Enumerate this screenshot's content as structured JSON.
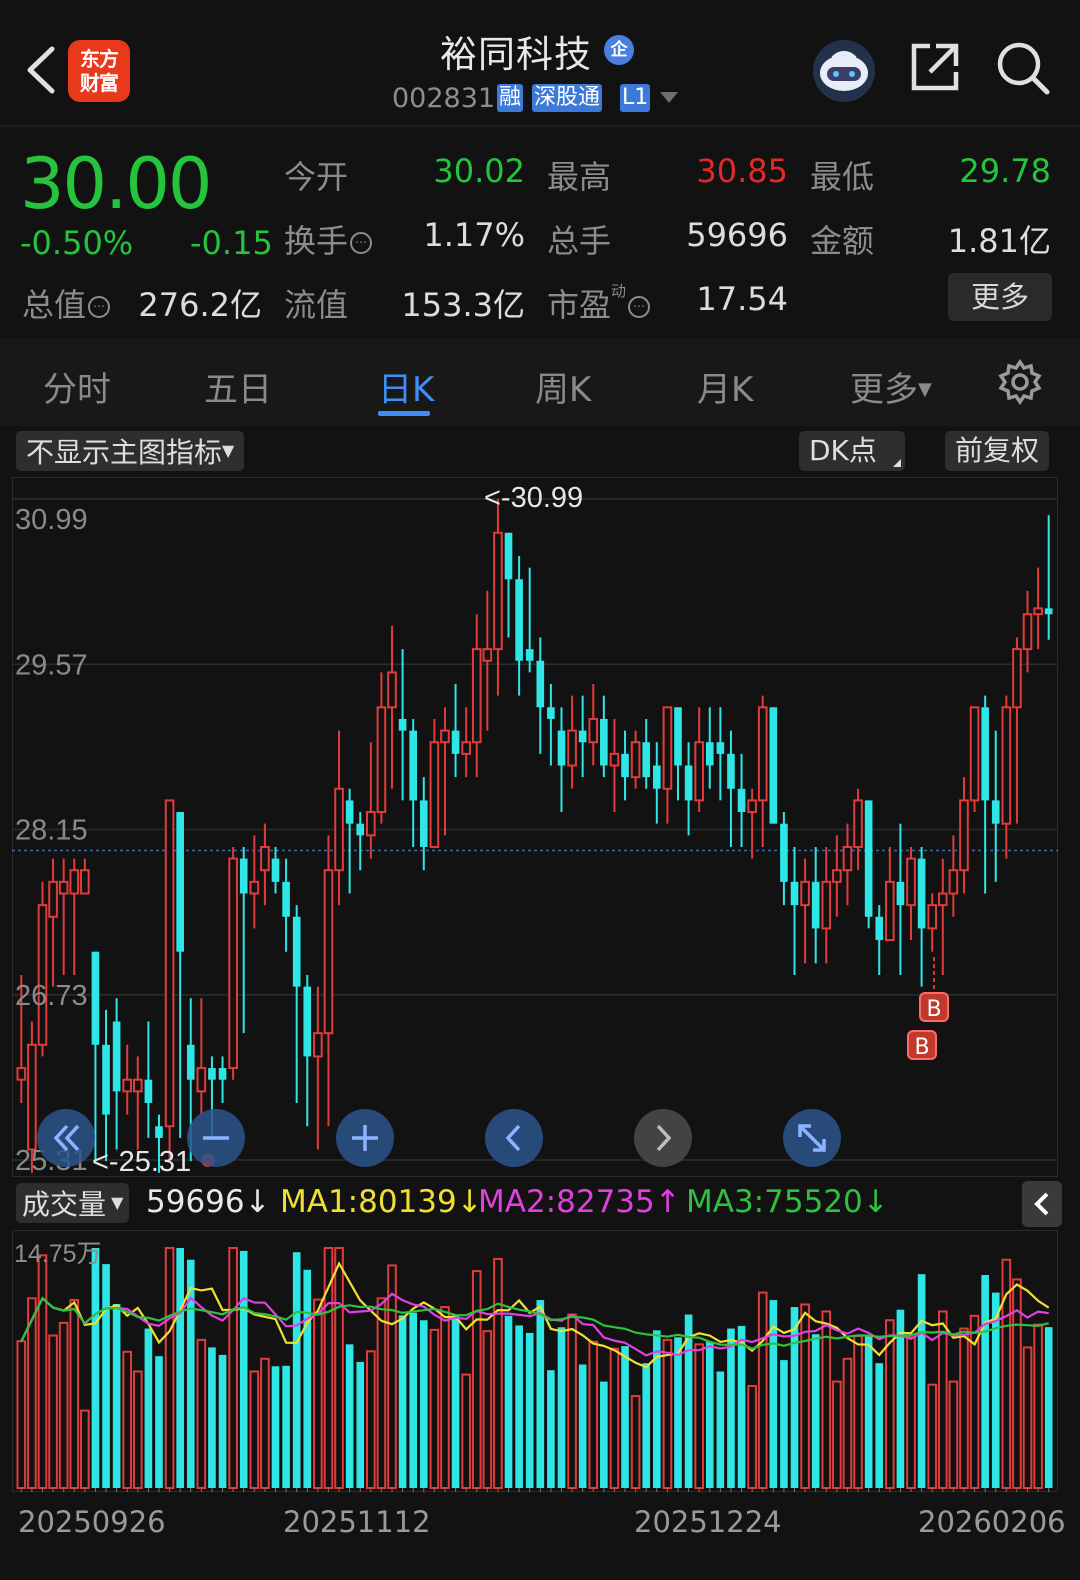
{
  "header": {
    "brand": "东方财富",
    "stock_name": "裕同科技",
    "qi_badge": "企",
    "code": "002831",
    "tags": [
      "融",
      "深股通",
      "L1"
    ]
  },
  "quote": {
    "price": "30.00",
    "pct_change": "-0.50%",
    "abs_change": "-0.15",
    "rows": [
      [
        {
          "label": "今开",
          "value": "30.02",
          "color": "#24c43c"
        },
        {
          "label": "最高",
          "value": "30.85",
          "color": "#e02a2a"
        },
        {
          "label": "最低",
          "value": "29.78",
          "color": "#24c43c"
        }
      ],
      [
        {
          "label": "换手",
          "value": "1.17%",
          "color": "#dcdcdc",
          "info": true
        },
        {
          "label": "总手",
          "value": "59696",
          "color": "#dcdcdc"
        },
        {
          "label": "金额",
          "value": "1.81亿",
          "color": "#dcdcdc"
        }
      ],
      [
        {
          "label": "总值",
          "value": "276.2亿",
          "color": "#dcdcdc",
          "info": true
        },
        {
          "label": "流值",
          "value": "153.3亿",
          "color": "#dcdcdc"
        },
        {
          "label": "市盈",
          "value": "17.54",
          "color": "#dcdcdc",
          "info": true,
          "sup": "动"
        }
      ]
    ],
    "more_label": "更多"
  },
  "tabs": {
    "items": [
      "分时",
      "五日",
      "日K",
      "周K",
      "月K",
      "更多"
    ],
    "active": "日K"
  },
  "toolbar": {
    "indicator_select": "不显示主图指标",
    "dk_label": "DK点",
    "adjust_label": "前复权"
  },
  "chart_data": {
    "type": "candlestick",
    "y_ticks": [
      "30.99",
      "29.57",
      "28.15",
      "26.73",
      "25.31"
    ],
    "ylim": [
      25.31,
      30.99
    ],
    "high_marker": "<-30.99",
    "low_marker": "<-25.31",
    "current_price_line": 27.97,
    "signal_labels": [
      "B",
      "B"
    ],
    "x_labels": [
      "20250926",
      "20251112",
      "20251224",
      "20260206"
    ],
    "candles": [
      [
        26.0,
        26.1,
        25.8,
        26.9
      ],
      [
        25.4,
        26.3,
        25.2,
        26.5
      ],
      [
        26.3,
        27.5,
        26.2,
        27.7
      ],
      [
        27.4,
        27.7,
        26.8,
        27.9
      ],
      [
        27.6,
        27.7,
        26.9,
        27.9
      ],
      [
        27.6,
        27.8,
        26.9,
        27.9
      ],
      [
        27.6,
        27.8,
        27.6,
        27.9
      ],
      [
        27.1,
        26.3,
        25.3,
        27.1
      ],
      [
        26.3,
        25.7,
        25.3,
        26.6
      ],
      [
        26.5,
        25.9,
        25.4,
        26.7
      ],
      [
        25.9,
        26.0,
        25.7,
        26.3
      ],
      [
        25.9,
        26.0,
        25.4,
        26.2
      ],
      [
        26.0,
        25.8,
        25.5,
        26.5
      ],
      [
        25.6,
        25.5,
        25.2,
        25.7
      ],
      [
        25.6,
        28.4,
        25.3,
        28.4
      ],
      [
        28.3,
        27.1,
        25.5,
        28.3
      ],
      [
        26.3,
        26.0,
        25.3,
        26.7
      ],
      [
        25.9,
        26.1,
        25.7,
        26.7
      ],
      [
        26.1,
        26.0,
        25.5,
        26.2
      ],
      [
        26.1,
        26.0,
        25.8,
        26.2
      ],
      [
        26.1,
        27.9,
        26.0,
        28.0
      ],
      [
        27.9,
        27.6,
        26.4,
        28.0
      ],
      [
        27.6,
        27.7,
        27.3,
        28.1
      ],
      [
        27.8,
        28.0,
        27.5,
        28.2
      ],
      [
        27.9,
        27.7,
        27.6,
        28.0
      ],
      [
        27.7,
        27.4,
        27.1,
        27.9
      ],
      [
        27.4,
        26.8,
        25.8,
        27.5
      ],
      [
        26.8,
        26.2,
        25.6,
        26.9
      ],
      [
        26.2,
        26.4,
        25.4,
        26.8
      ],
      [
        26.4,
        27.8,
        25.6,
        28.1
      ],
      [
        27.8,
        28.5,
        27.5,
        29.0
      ],
      [
        28.4,
        28.2,
        27.6,
        28.5
      ],
      [
        28.2,
        28.1,
        27.8,
        28.3
      ],
      [
        28.1,
        28.3,
        27.9,
        28.9
      ],
      [
        28.3,
        29.2,
        28.2,
        29.5
      ],
      [
        29.2,
        29.5,
        28.5,
        29.9
      ],
      [
        29.1,
        29.0,
        28.4,
        29.7
      ],
      [
        29.0,
        28.4,
        28.0,
        29.1
      ],
      [
        28.4,
        28.0,
        27.8,
        28.6
      ],
      [
        28.0,
        28.9,
        28.0,
        29.1
      ],
      [
        28.9,
        29.0,
        28.1,
        29.2
      ],
      [
        29.0,
        28.8,
        28.6,
        29.4
      ],
      [
        28.8,
        28.9,
        28.6,
        29.2
      ],
      [
        28.9,
        29.7,
        28.6,
        30.0
      ],
      [
        29.6,
        29.7,
        29.0,
        30.2
      ],
      [
        29.7,
        30.7,
        29.3,
        30.99
      ],
      [
        30.7,
        30.3,
        29.8,
        30.7
      ],
      [
        30.3,
        29.6,
        29.3,
        30.5
      ],
      [
        29.7,
        29.6,
        29.5,
        30.4
      ],
      [
        29.6,
        29.2,
        28.8,
        29.8
      ],
      [
        29.2,
        29.1,
        28.7,
        29.4
      ],
      [
        29.0,
        28.7,
        28.3,
        29.2
      ],
      [
        28.7,
        29.0,
        28.5,
        29.3
      ],
      [
        29.0,
        28.9,
        28.6,
        29.3
      ],
      [
        28.9,
        29.1,
        28.7,
        29.4
      ],
      [
        29.1,
        28.7,
        28.6,
        29.3
      ],
      [
        28.7,
        28.8,
        28.3,
        29.1
      ],
      [
        28.8,
        28.6,
        28.4,
        29.0
      ],
      [
        28.6,
        28.9,
        28.5,
        29.0
      ],
      [
        28.9,
        28.6,
        28.5,
        29.1
      ],
      [
        28.7,
        28.5,
        28.2,
        28.9
      ],
      [
        28.5,
        29.2,
        28.2,
        29.2
      ],
      [
        29.2,
        28.7,
        28.4,
        29.2
      ],
      [
        28.7,
        28.4,
        28.1,
        28.9
      ],
      [
        28.4,
        28.9,
        28.3,
        29.2
      ],
      [
        28.9,
        28.7,
        28.5,
        29.2
      ],
      [
        28.9,
        28.8,
        28.4,
        29.2
      ],
      [
        28.8,
        28.5,
        28.0,
        29.0
      ],
      [
        28.5,
        28.3,
        28.0,
        28.8
      ],
      [
        28.3,
        28.4,
        27.9,
        28.5
      ],
      [
        28.4,
        29.2,
        28.0,
        29.3
      ],
      [
        29.2,
        28.2,
        28.2,
        29.2
      ],
      [
        28.2,
        27.7,
        27.5,
        28.3
      ],
      [
        27.7,
        27.5,
        26.9,
        28.0
      ],
      [
        27.5,
        27.7,
        27.0,
        27.9
      ],
      [
        27.7,
        27.3,
        27.0,
        28.0
      ],
      [
        27.3,
        27.7,
        27.0,
        28.0
      ],
      [
        27.7,
        27.8,
        27.4,
        28.1
      ],
      [
        27.8,
        28.0,
        27.5,
        28.2
      ],
      [
        28.0,
        28.4,
        27.8,
        28.5
      ],
      [
        28.4,
        27.4,
        27.3,
        28.4
      ],
      [
        27.4,
        27.2,
        26.9,
        27.5
      ],
      [
        27.2,
        27.7,
        27.2,
        28.0
      ],
      [
        27.7,
        27.5,
        26.9,
        28.2
      ],
      [
        27.5,
        27.9,
        27.2,
        28.0
      ],
      [
        27.9,
        27.3,
        26.8,
        28.0
      ],
      [
        27.3,
        27.5,
        27.1,
        27.6
      ],
      [
        27.5,
        27.6,
        26.9,
        27.9
      ],
      [
        27.6,
        27.8,
        27.4,
        28.1
      ],
      [
        27.8,
        28.4,
        27.6,
        28.6
      ],
      [
        28.4,
        29.2,
        28.3,
        29.2
      ],
      [
        29.2,
        28.4,
        27.6,
        29.3
      ],
      [
        28.4,
        28.2,
        27.7,
        29.0
      ],
      [
        28.2,
        29.2,
        27.9,
        29.3
      ],
      [
        29.2,
        29.7,
        28.2,
        29.8
      ],
      [
        29.7,
        30.0,
        29.5,
        30.2
      ],
      [
        30.0,
        30.05,
        29.7,
        30.4
      ],
      [
        30.05,
        30.0,
        29.78,
        30.85
      ]
    ]
  },
  "volume": {
    "label": "成交量",
    "current": "59696↓",
    "ma1": "MA1:80139↓",
    "ma2": "MA2:82735↑",
    "ma3": "MA3:75520↓",
    "ma1_color": "#f0e030",
    "ma2_color": "#e040e0",
    "ma3_color": "#30c040",
    "max_label": "14.75万",
    "max_value": 147500
  }
}
